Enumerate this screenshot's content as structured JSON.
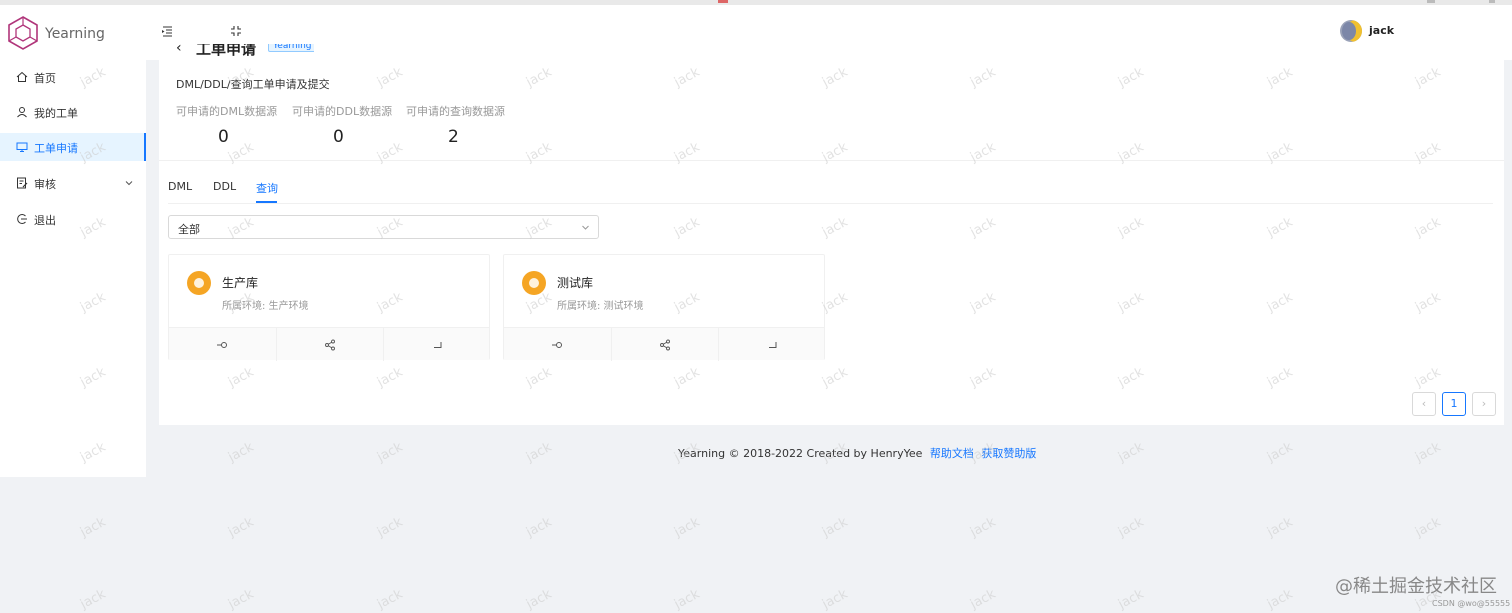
{
  "app": {
    "logo_text": "Yearning"
  },
  "header": {
    "user_name": "jack"
  },
  "sidebar": {
    "items": [
      {
        "label": "首页",
        "icon": "home-icon"
      },
      {
        "label": "我的工单",
        "icon": "user-icon"
      },
      {
        "label": "工单申请",
        "icon": "monitor-icon",
        "active": true
      },
      {
        "label": "审核",
        "icon": "audit-icon",
        "expandable": true
      },
      {
        "label": "退出",
        "icon": "logout-icon"
      }
    ]
  },
  "page": {
    "title": "工单申请",
    "tag": "Yearning",
    "subtitle": "DML/DDL/查询工单申请及提交",
    "stats": [
      {
        "label": "可申请的DML数据源",
        "value": "0"
      },
      {
        "label": "可申请的DDL数据源",
        "value": "0"
      },
      {
        "label": "可申请的查询数据源",
        "value": "2"
      }
    ]
  },
  "tabs": [
    {
      "label": "DML"
    },
    {
      "label": "DDL"
    },
    {
      "label": "查询",
      "active": true
    }
  ],
  "filter": {
    "selected": "全部"
  },
  "cards": [
    {
      "name": "生产库",
      "env": "所属环境: 生产环境"
    },
    {
      "name": "测试库",
      "env": "所属环境: 测试环境"
    }
  ],
  "pagination": {
    "current": "1"
  },
  "footer": {
    "text": "Yearning © 2018-2022 Created by HenryYee",
    "link_docs": "帮助文档",
    "link_sponsor": "获取赞助版"
  },
  "watermark": {
    "text": "jack"
  },
  "overlay": {
    "brand": "@稀土掘金技术社区",
    "csdn": "CSDN @wo@55555"
  },
  "colors": {
    "accent": "#1677ff",
    "card_icon": "#f5a524",
    "background": "#f0f2f5"
  }
}
